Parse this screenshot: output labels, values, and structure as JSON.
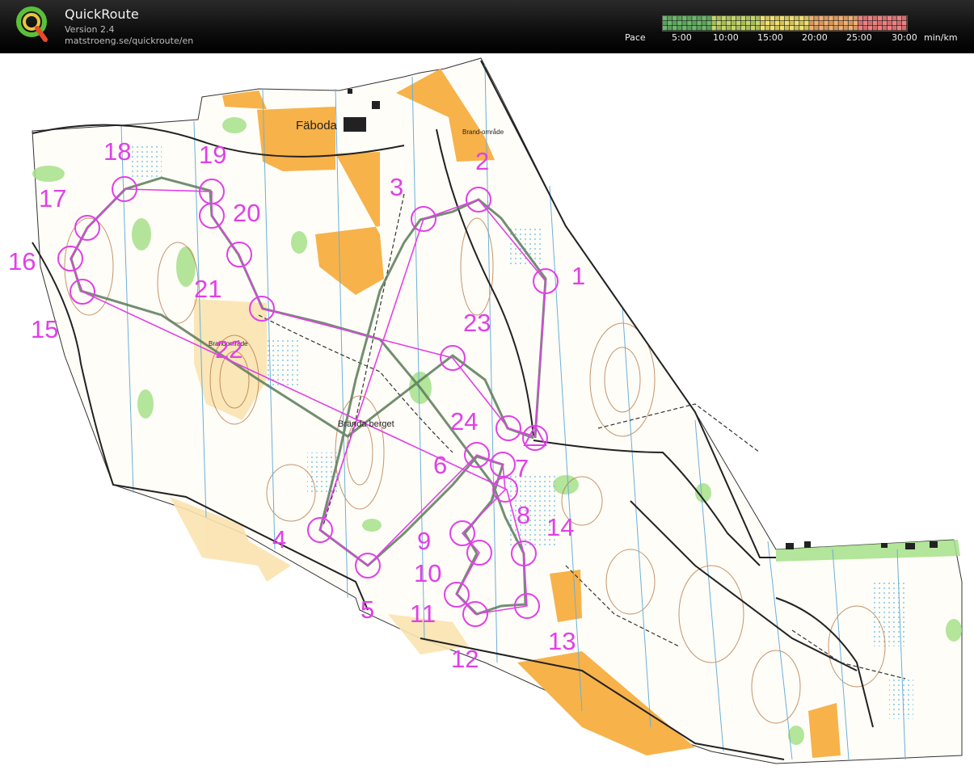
{
  "header": {
    "app_title": "QuickRoute",
    "version": "Version 2.4",
    "url": "matstroeng.se/quickroute/en",
    "pace_label": "Pace",
    "pace_ticks": [
      "5:00",
      "10:00",
      "15:00",
      "20:00",
      "25:00",
      "30:00"
    ],
    "pace_unit": "min/km",
    "pace_colors": [
      "#6cb86c",
      "#c3d86a",
      "#f0e070",
      "#f4b070",
      "#f08080"
    ]
  },
  "map": {
    "place_labels": [
      "Fäboda",
      "Brända berget",
      "Brand-område",
      "Brandområde"
    ],
    "controls": [
      "1",
      "2",
      "3",
      "4",
      "5",
      "6",
      "7",
      "8",
      "9",
      "10",
      "11",
      "12",
      "13",
      "14",
      "15",
      "16",
      "17",
      "18",
      "19",
      "20",
      "21",
      "22",
      "23",
      "24"
    ],
    "colors": {
      "course": "#e040e8",
      "route": "#5a7a5a",
      "field": "#f7b24a",
      "forest_green": "#a6e08a",
      "contour": "#b0713c",
      "water": "#a8d8f0"
    }
  }
}
